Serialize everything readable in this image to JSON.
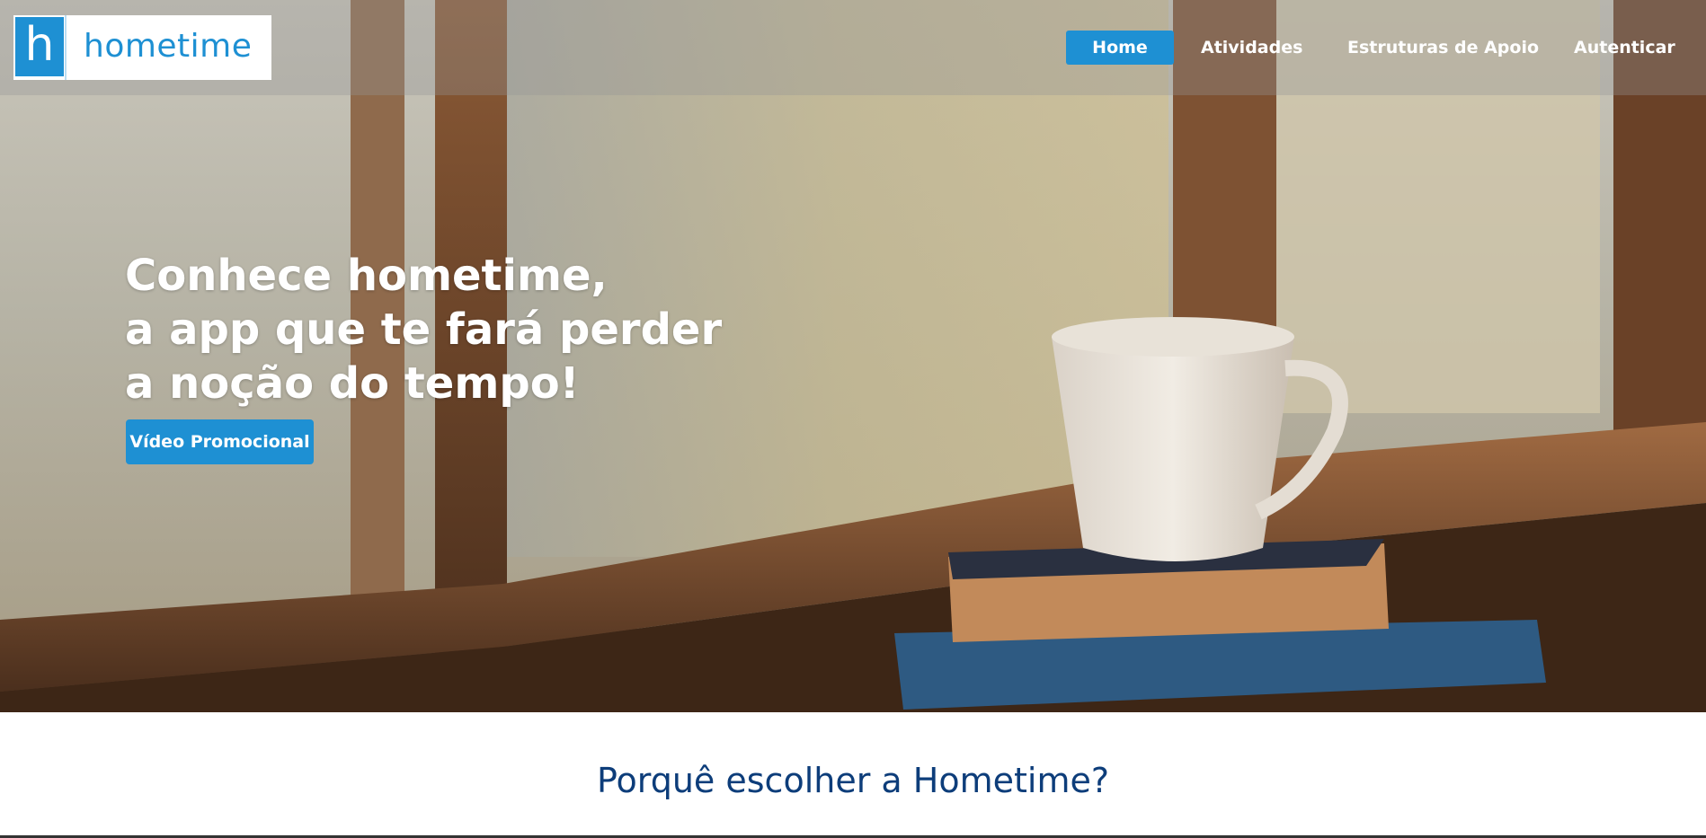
{
  "brand": {
    "logo_letter": "h",
    "logo_text": "hometime",
    "color": "#1e90d3"
  },
  "nav": {
    "items": [
      {
        "label": "Home",
        "active": true
      },
      {
        "label": "Atividades",
        "active": false
      },
      {
        "label": "Estruturas de Apoio",
        "active": false
      },
      {
        "label": "Autenticar",
        "active": false
      }
    ]
  },
  "hero": {
    "headline_lines": [
      "Conhece hometime,",
      "a app que te fará perder",
      "a noção do tempo!"
    ],
    "button_label": "Vídeo Promocional"
  },
  "section": {
    "title": "Porquê escolher a Hometime?",
    "title_color": "#0d3d7a"
  }
}
